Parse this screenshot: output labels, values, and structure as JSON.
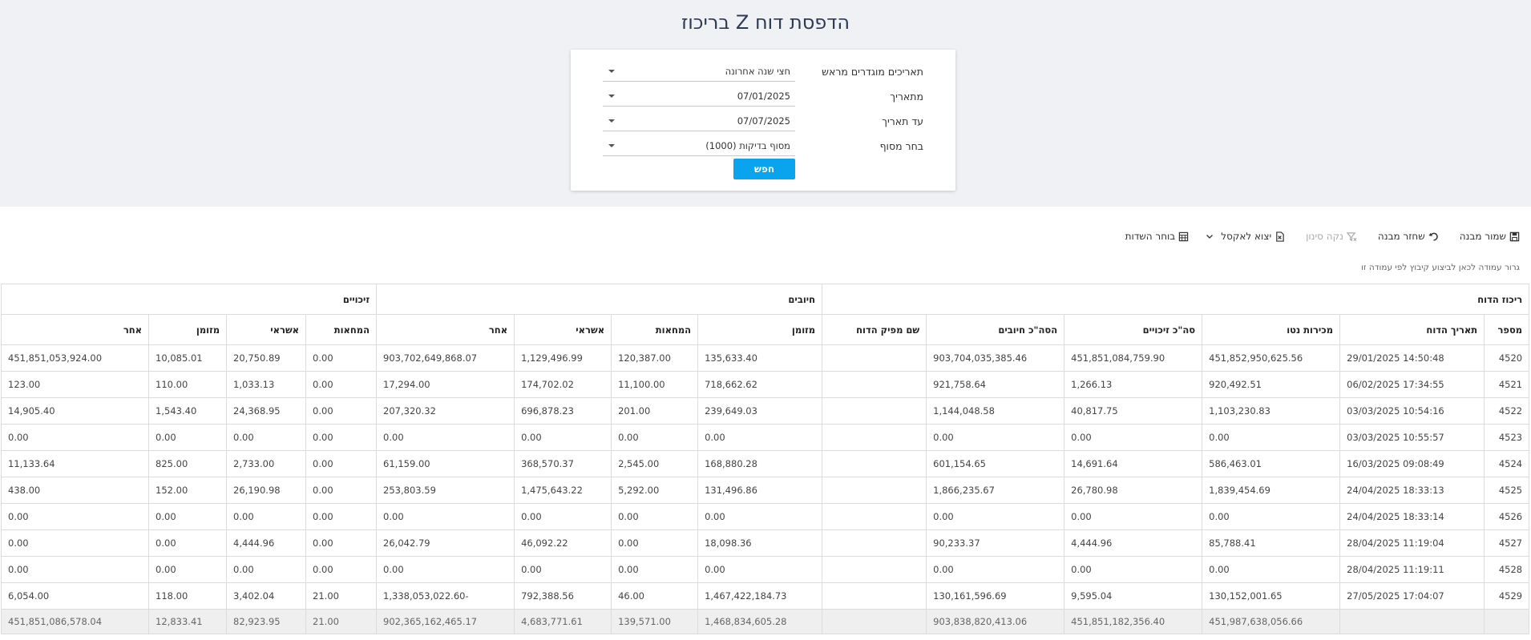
{
  "title": "הדפסת דוח Z בריכוז",
  "filters": [
    {
      "label": "תאריכים מוגדרים מראש",
      "value": "חצי שנה אחרונה"
    },
    {
      "label": "מתאריך",
      "value": "07/01/2025"
    },
    {
      "label": "עד תאריך",
      "value": "07/07/2025"
    },
    {
      "label": "בחר מסוף",
      "value": "מסוף בדיקות  (1000)"
    }
  ],
  "search_label": "חפש",
  "toolbar": {
    "save_layout": "שמור מבנה",
    "restore_layout": "שחזר מבנה",
    "clear_filter": "נקה סינון",
    "export_excel": "יצוא לאקסל",
    "field_chooser": "בוחר השדות"
  },
  "group_hint": "גרור עמודה לכאן לביצוע קיבוץ לפי עמודה זו",
  "group_headers": {
    "summary": "ריכוז הדוח",
    "debits": "חיובים",
    "credits": "זיכויים"
  },
  "columns": [
    "מספר",
    "תאריך הדוח",
    "מכירות נטו",
    "סה\"כ זיכויים",
    "הסה\"כ חיובים",
    "שם מפיק הדוח",
    "מזומן",
    "המחאות",
    "אשראי",
    "אחר",
    "המחאות",
    "אשראי",
    "מזומן",
    "אחר"
  ],
  "rows": [
    [
      "4520",
      "14:50:48 29/01/2025",
      "451,852,950,625.56",
      "451,851,084,759.90",
      "903,704,035,385.46",
      "",
      "135,633.40",
      "120,387.00",
      "1,129,496.99",
      "903,702,649,868.07",
      "0.00",
      "20,750.89",
      "10,085.01",
      "451,851,053,924.00"
    ],
    [
      "4521",
      "17:34:55 06/02/2025",
      "920,492.51",
      "1,266.13",
      "921,758.64",
      "",
      "718,662.62",
      "11,100.00",
      "174,702.02",
      "17,294.00",
      "0.00",
      "1,033.13",
      "110.00",
      "123.00"
    ],
    [
      "4522",
      "10:54:16 03/03/2025",
      "1,103,230.83",
      "40,817.75",
      "1,144,048.58",
      "",
      "239,649.03",
      "201.00",
      "696,878.23",
      "207,320.32",
      "0.00",
      "24,368.95",
      "1,543.40",
      "14,905.40"
    ],
    [
      "4523",
      "10:55:57 03/03/2025",
      "0.00",
      "0.00",
      "0.00",
      "",
      "0.00",
      "0.00",
      "0.00",
      "0.00",
      "0.00",
      "0.00",
      "0.00",
      "0.00"
    ],
    [
      "4524",
      "09:08:49 16/03/2025",
      "586,463.01",
      "14,691.64",
      "601,154.65",
      "",
      "168,880.28",
      "2,545.00",
      "368,570.37",
      "61,159.00",
      "0.00",
      "2,733.00",
      "825.00",
      "11,133.64"
    ],
    [
      "4525",
      "18:33:13 24/04/2025",
      "1,839,454.69",
      "26,780.98",
      "1,866,235.67",
      "",
      "131,496.86",
      "5,292.00",
      "1,475,643.22",
      "253,803.59",
      "0.00",
      "26,190.98",
      "152.00",
      "438.00"
    ],
    [
      "4526",
      "18:33:14 24/04/2025",
      "0.00",
      "0.00",
      "0.00",
      "",
      "0.00",
      "0.00",
      "0.00",
      "0.00",
      "0.00",
      "0.00",
      "0.00",
      "0.00"
    ],
    [
      "4527",
      "11:19:04 28/04/2025",
      "85,788.41",
      "4,444.96",
      "90,233.37",
      "",
      "18,098.36",
      "0.00",
      "46,092.22",
      "26,042.79",
      "0.00",
      "4,444.96",
      "0.00",
      "0.00"
    ],
    [
      "4528",
      "11:19:11 28/04/2025",
      "0.00",
      "0.00",
      "0.00",
      "",
      "0.00",
      "0.00",
      "0.00",
      "0.00",
      "0.00",
      "0.00",
      "0.00",
      "0.00"
    ],
    [
      "4529",
      "17:04:07 27/05/2025",
      "130,152,001.65",
      "9,595.04",
      "130,161,596.69",
      "",
      "1,467,422,184.73",
      "46.00",
      "792,388.56",
      "-1,338,053,022.60",
      "21.00",
      "3,402.04",
      "118.00",
      "6,054.00"
    ]
  ],
  "totals": [
    "",
    "",
    "451,987,638,056.66",
    "451,851,182,356.40",
    "903,838,820,413.06",
    "",
    "1,468,834,605.28",
    "139,571.00",
    "4,683,771.61",
    "902,365,162,465.17",
    "21.00",
    "82,923.95",
    "12,833.41",
    "451,851,086,578.04"
  ]
}
